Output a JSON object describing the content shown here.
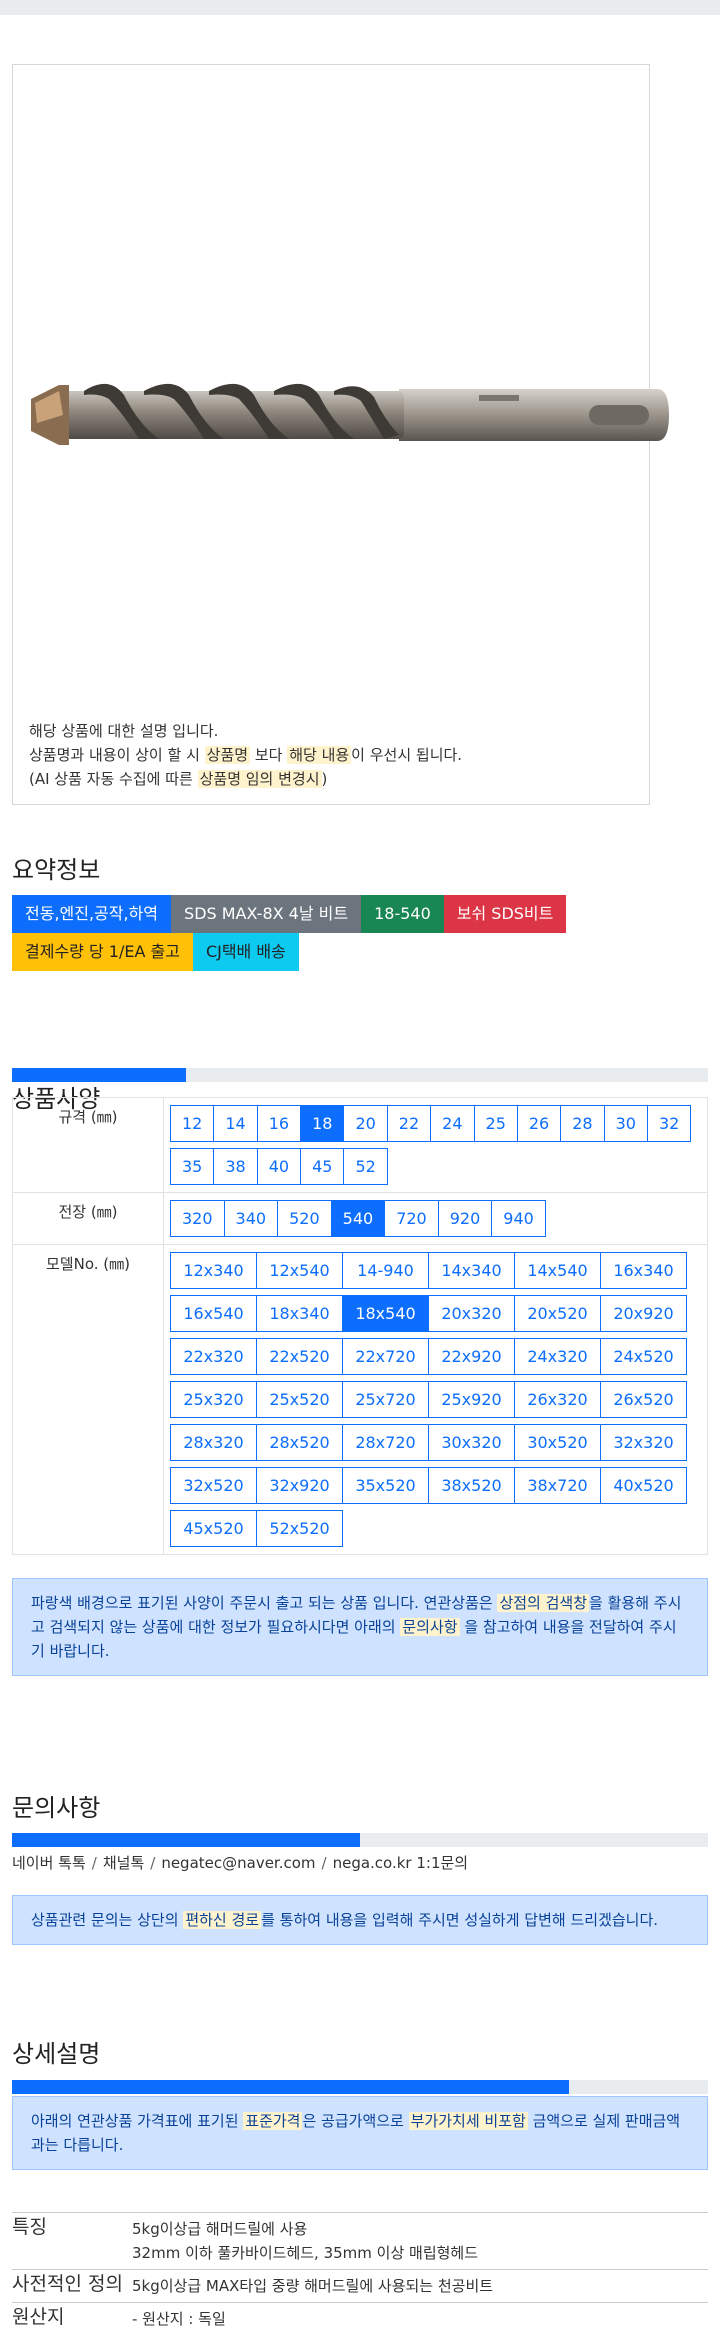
{
  "description": {
    "line1": "해당 상품에 대한 설명 입니다.",
    "line2_pre": "상품명과 내용이 상이 할 시 ",
    "line2_hl1": "상품명",
    "line2_mid": " 보다 ",
    "line2_hl2": "해당 내용",
    "line2_post": "이 우선시 됩니다.",
    "line3_pre": "(AI 상품 자동 수집에 따른 ",
    "line3_hl": "상품명 임의 변경시",
    "line3_post": ")"
  },
  "summary": {
    "title": "요약정보",
    "badges": [
      {
        "label": "전동,엔진,공작,하역",
        "color": "#0d6efd"
      },
      {
        "label": "SDS MAX-8X 4날 비트",
        "color": "#6c757d"
      },
      {
        "label": "18-540",
        "color": "#198754"
      },
      {
        "label": "보쉬 SDS비트",
        "color": "#dc3545"
      },
      {
        "label": "결제수량 당 1/EA 출고",
        "color": "#ffc107",
        "text": "#222222"
      },
      {
        "label": "CJ택배 배송",
        "color": "#0dcaf0",
        "text": "#222222"
      }
    ]
  },
  "spec": {
    "title": "상품사양",
    "progress": 0.25,
    "rows": [
      {
        "label": "규격 (㎜)",
        "options": [
          "12",
          "14",
          "16",
          "18",
          "20",
          "22",
          "24",
          "25",
          "26",
          "28",
          "30",
          "32",
          "35",
          "38",
          "40",
          "45",
          "52"
        ],
        "selected": "18",
        "wide": false
      },
      {
        "label": "전장 (㎜)",
        "options": [
          "320",
          "340",
          "520",
          "540",
          "720",
          "920",
          "940"
        ],
        "selected": "540",
        "wide": false
      },
      {
        "label": "모델No. (㎜)",
        "options": [
          "12x340",
          "12x540",
          "14-940",
          "14x340",
          "14x540",
          "16x340",
          "16x540",
          "18x340",
          "18x540",
          "20x320",
          "20x520",
          "20x920",
          "22x320",
          "22x520",
          "22x720",
          "22x920",
          "24x320",
          "24x520",
          "25x320",
          "25x520",
          "25x720",
          "25x920",
          "26x320",
          "26x520",
          "28x320",
          "28x520",
          "28x720",
          "30x320",
          "30x520",
          "32x320",
          "32x520",
          "32x920",
          "35x520",
          "38x520",
          "38x720",
          "40x520",
          "45x520",
          "52x520"
        ],
        "selected": "18x540",
        "wide": true
      }
    ],
    "notice": {
      "pre": "파랑색 배경으로 표기된 사양이 주문시 출고 되는 상품 입니다. 연관상품은 ",
      "hl1": "상점의 검색창",
      "mid": "을 활용해 주시고 검색되지 않는 상품에 대한 정보가 필요하시다면 아래의 ",
      "hl2": "문의사항",
      "post": " 을 참고하여 내용을 전달하여 주시기 바랍니다."
    }
  },
  "inquiry": {
    "title": "문의사항",
    "progress": 0.5,
    "contacts": [
      "네이버 톡톡",
      "채널톡",
      "negatec@naver.com",
      "nega.co.kr 1:1문의"
    ],
    "notice": {
      "pre": "상품관련 문의는 상단의 ",
      "hl": "편하신 경로",
      "post": "를 통하여 내용을 입력해 주시면 성실하게 답변해 드리겠습니다."
    }
  },
  "detail": {
    "title": "상세설명",
    "progress": 0.8,
    "notice": {
      "pre": "아래의 연관상품 가격표에 표기된 ",
      "hl1": "표준가격",
      "mid": "은 공급가액으로 ",
      "hl2": "부가가치세 비포함",
      "post": " 금액으로 실제 판매금액과는 다릅니다."
    },
    "rows": [
      {
        "key": "특징",
        "lines": [
          "5kg이상급 해머드릴에 사용",
          "32mm 이하 풀카바이드헤드, 35mm 이상 매립형헤드"
        ]
      },
      {
        "key": "사전적인 정의",
        "lines": [
          "5kg이상급 MAX타입 중량 해머드릴에 사용되는 천공비트"
        ]
      },
      {
        "key": "원산지",
        "lines": [
          "- 원산지 : 독일"
        ]
      }
    ]
  }
}
